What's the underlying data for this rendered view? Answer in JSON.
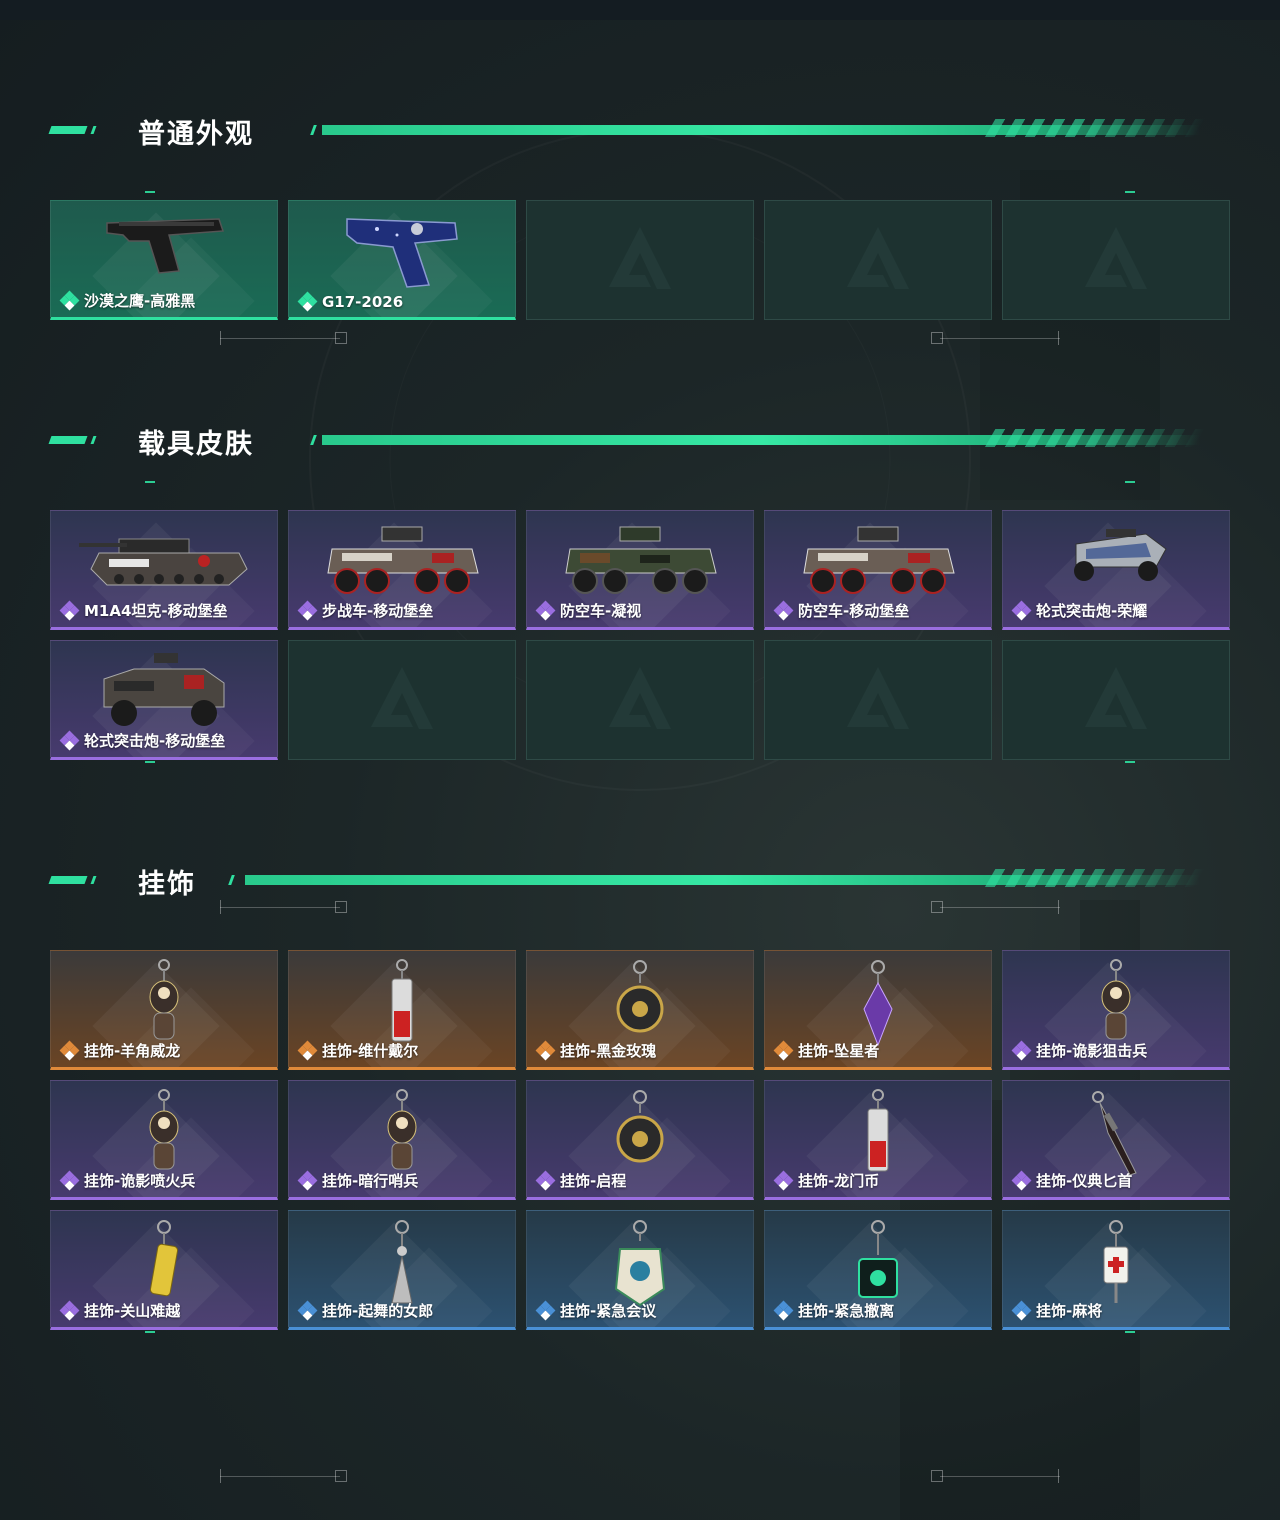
{
  "sections": [
    {
      "title": "普通外观",
      "items": [
        {
          "label": "沙漠之鹰-高雅黑",
          "rarity": "green",
          "art": "pistol-black"
        },
        {
          "label": "G17-2026",
          "rarity": "green",
          "art": "pistol-blue"
        },
        {
          "label": "",
          "rarity": "empty"
        },
        {
          "label": "",
          "rarity": "empty"
        },
        {
          "label": "",
          "rarity": "empty"
        }
      ]
    },
    {
      "title": "载具皮肤",
      "items": [
        {
          "label": "M1A4坦克-移动堡垒",
          "rarity": "purple",
          "art": "tank"
        },
        {
          "label": "步战车-移动堡垒",
          "rarity": "purple",
          "art": "apc"
        },
        {
          "label": "防空车-凝视",
          "rarity": "purple",
          "art": "apc-camo"
        },
        {
          "label": "防空车-移动堡垒",
          "rarity": "purple",
          "art": "apc"
        },
        {
          "label": "轮式突击炮-荣耀",
          "rarity": "purple",
          "art": "buggy"
        },
        {
          "label": "轮式突击炮-移动堡垒",
          "rarity": "purple",
          "art": "armored-car"
        },
        {
          "label": "",
          "rarity": "empty"
        },
        {
          "label": "",
          "rarity": "empty"
        },
        {
          "label": "",
          "rarity": "empty"
        },
        {
          "label": "",
          "rarity": "empty"
        }
      ]
    },
    {
      "title": "挂饰",
      "items": [
        {
          "label": "挂饰-羊角威龙",
          "rarity": "orange",
          "art": "charm-figure"
        },
        {
          "label": "挂饰-维什戴尔",
          "rarity": "orange",
          "art": "charm-tag"
        },
        {
          "label": "挂饰-黑金玫瑰",
          "rarity": "orange",
          "art": "charm-round"
        },
        {
          "label": "挂饰-坠星者",
          "rarity": "orange",
          "art": "charm-crystal"
        },
        {
          "label": "挂饰-诡影狙击兵",
          "rarity": "purple",
          "art": "charm-figure"
        },
        {
          "label": "挂饰-诡影喷火兵",
          "rarity": "purple",
          "art": "charm-figure"
        },
        {
          "label": "挂饰-暗行哨兵",
          "rarity": "purple",
          "art": "charm-figure"
        },
        {
          "label": "挂饰-启程",
          "rarity": "purple",
          "art": "charm-round"
        },
        {
          "label": "挂饰-龙门币",
          "rarity": "purple",
          "art": "charm-tag"
        },
        {
          "label": "挂饰-仪典匕首",
          "rarity": "purple",
          "art": "charm-dagger"
        },
        {
          "label": "挂饰-关山难越",
          "rarity": "purple",
          "art": "charm-gold"
        },
        {
          "label": "挂饰-起舞的女郎",
          "rarity": "blue",
          "art": "charm-dancer"
        },
        {
          "label": "挂饰-紧急会议",
          "rarity": "blue",
          "art": "charm-badge"
        },
        {
          "label": "挂饰-紧急撤离",
          "rarity": "blue",
          "art": "charm-square"
        },
        {
          "label": "挂饰-麻将",
          "rarity": "blue",
          "art": "charm-mahjong"
        }
      ]
    }
  ],
  "colors": {
    "accent": "#2fe0a0",
    "green": "#2fe0a0",
    "purple": "#9a6ee0",
    "orange": "#e08a3a",
    "blue": "#4a90d6"
  }
}
